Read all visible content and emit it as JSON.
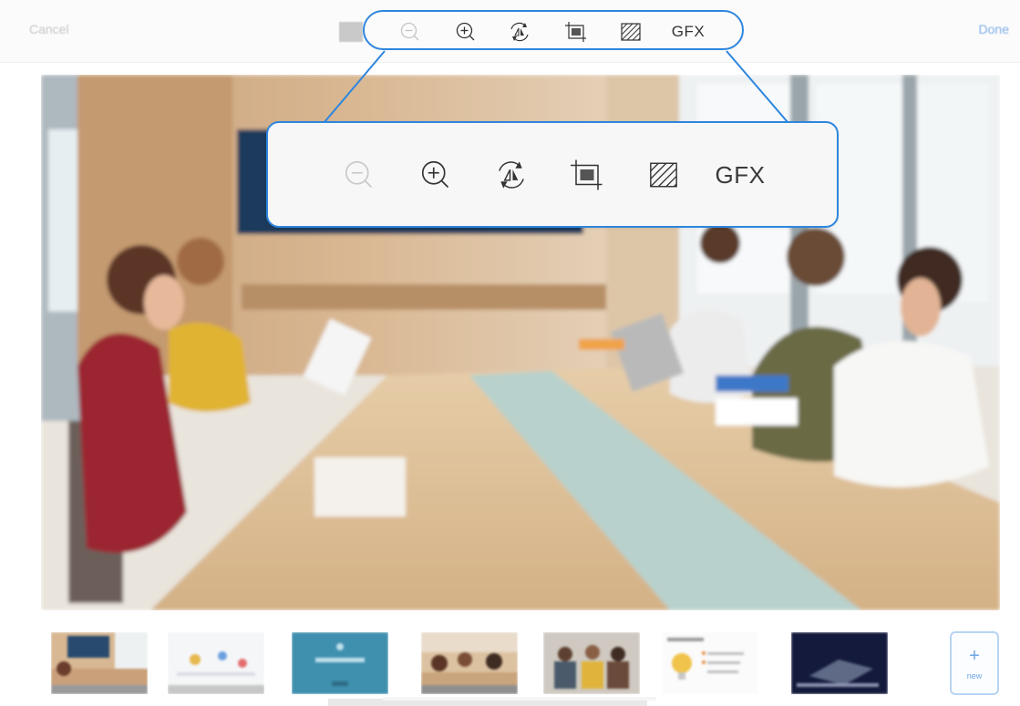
{
  "topbar": {
    "cancel_label": "Cancel",
    "done_label": "Done"
  },
  "toolbar": {
    "tools": [
      {
        "name": "zoom-out",
        "icon": "zoom-out-icon",
        "enabled": false
      },
      {
        "name": "zoom-in",
        "icon": "zoom-in-icon",
        "enabled": true
      },
      {
        "name": "flip-rotate",
        "icon": "flip-rotate-icon",
        "enabled": true
      },
      {
        "name": "crop",
        "icon": "crop-icon",
        "enabled": true
      },
      {
        "name": "pattern",
        "icon": "hatch-icon",
        "enabled": true
      },
      {
        "name": "gfx",
        "label": "GFX",
        "enabled": true
      }
    ],
    "gfx_label": "GFX"
  },
  "zoom_callout": {
    "gfx_label": "GFX"
  },
  "thumbnails": {
    "add_label": "+",
    "add_sub_label": "new"
  },
  "colors": {
    "accent": "#2e86de",
    "done_text": "#7fb0e6",
    "disabled_icon": "#c4c4c4"
  }
}
